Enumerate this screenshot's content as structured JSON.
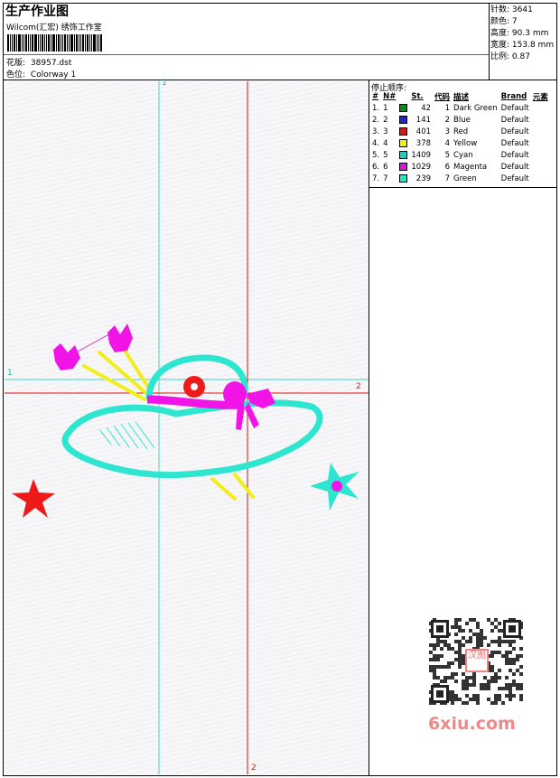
{
  "header": {
    "title": "生产作业图",
    "company": "Wilcom(汇宏) 绣饰工作室",
    "design_label": "花版:",
    "design_value": "38957.dst",
    "colorway_label": "色位:",
    "colorway_value": "Colorway 1"
  },
  "stats": [
    {
      "label": "针数:",
      "value": "3641"
    },
    {
      "label": "颜色:",
      "value": "7"
    },
    {
      "label": "高度:",
      "value": "90.3 mm"
    },
    {
      "label": "宽度:",
      "value": "153.8 mm"
    },
    {
      "label": "比例:",
      "value": "0.87"
    }
  ],
  "stop_sequence": {
    "title": "停止顺序:",
    "columns": [
      "#",
      "N#",
      "St.",
      "代码",
      "描述",
      "Brand",
      "元素"
    ],
    "rows": [
      {
        "num": "1.",
        "n": "1",
        "color": "#0b8a1a",
        "st": "42",
        "code": "1",
        "desc": "Dark Green",
        "brand": "Default"
      },
      {
        "num": "2.",
        "n": "2",
        "color": "#1f24e0",
        "st": "141",
        "code": "2",
        "desc": "Blue",
        "brand": "Default"
      },
      {
        "num": "3.",
        "n": "3",
        "color": "#e01616",
        "st": "401",
        "code": "3",
        "desc": "Red",
        "brand": "Default"
      },
      {
        "num": "4.",
        "n": "4",
        "color": "#f2f200",
        "st": "378",
        "code": "4",
        "desc": "Yellow",
        "brand": "Default"
      },
      {
        "num": "5.",
        "n": "5",
        "color": "#15d3c0",
        "st": "1409",
        "code": "5",
        "desc": "Cyan",
        "brand": "Default"
      },
      {
        "num": "6.",
        "n": "6",
        "color": "#e010e0",
        "st": "1029",
        "code": "6",
        "desc": "Magenta",
        "brand": "Default"
      },
      {
        "num": "7.",
        "n": "7",
        "color": "#1fe8c8",
        "st": "239",
        "code": "7",
        "desc": "Green",
        "brand": "Default"
      }
    ]
  },
  "guides": {
    "cyan_label_top": "1",
    "cyan_label_left": "1",
    "red_label_right": "2",
    "red_label_bottom": "2"
  },
  "watermark": {
    "stamp_text": "汉图",
    "text": "6xiu.com"
  },
  "colors": {
    "cyan_guide": "#3fd6c6",
    "red_guide": "#e01010",
    "hat": "#2ee6cf",
    "magenta": "#f014e6",
    "red": "#ee1a1a",
    "yellow": "#f2ee1c"
  }
}
